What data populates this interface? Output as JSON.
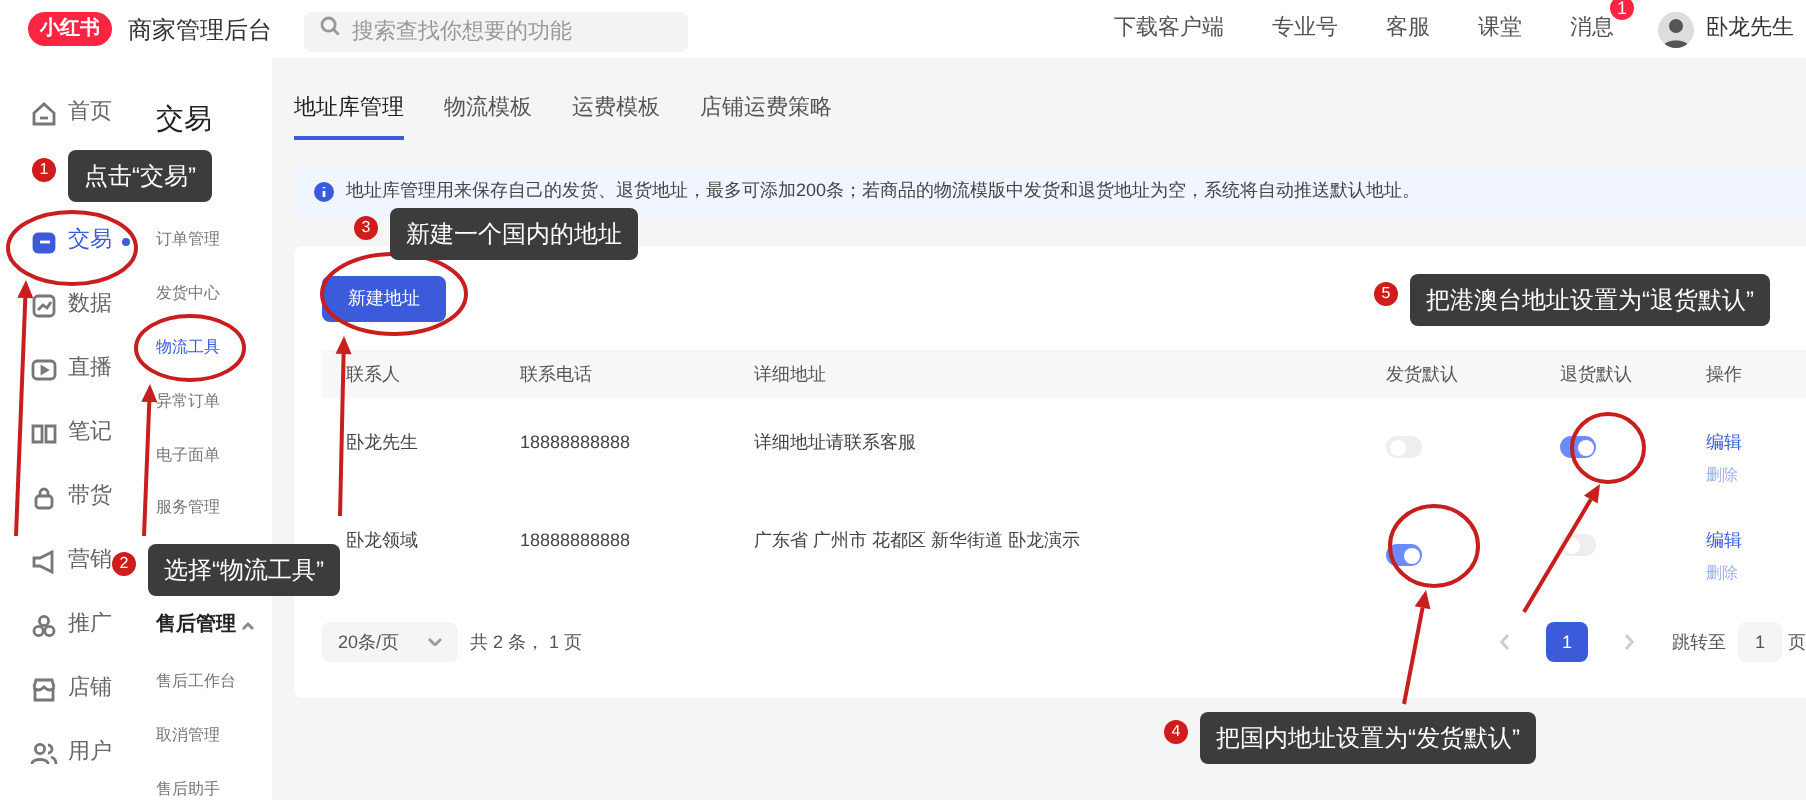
{
  "app": {
    "logo": "小红书",
    "title": "商家管理后台"
  },
  "search": {
    "placeholder": "搜索查找你想要的功能"
  },
  "top_links": [
    {
      "label": "下载客户端"
    },
    {
      "label": "专业号"
    },
    {
      "label": "客服"
    },
    {
      "label": "课堂"
    },
    {
      "label": "消息",
      "badge": "1"
    }
  ],
  "user": {
    "name": "卧龙先生"
  },
  "nav": [
    {
      "label": "首页",
      "selected": false
    },
    {
      "label": "交易",
      "selected": true
    },
    {
      "label": "数据",
      "selected": false
    },
    {
      "label": "直播",
      "selected": false
    },
    {
      "label": "笔记",
      "selected": false
    },
    {
      "label": "带货",
      "selected": false
    },
    {
      "label": "营销",
      "selected": false
    },
    {
      "label": "推广",
      "selected": false
    },
    {
      "label": "店铺",
      "selected": false
    },
    {
      "label": "用户",
      "selected": false
    }
  ],
  "submenu": {
    "title": "交易",
    "groups": [
      {
        "items": [
          {
            "label": "订单管理",
            "selected": false
          },
          {
            "label": "发货中心",
            "selected": false
          },
          {
            "label": "物流工具",
            "selected": true
          },
          {
            "label": "异常订单",
            "selected": false
          },
          {
            "label": "电子面单",
            "selected": false
          },
          {
            "label": "服务管理",
            "selected": false
          }
        ]
      },
      {
        "title": "售后管理",
        "expanded": true,
        "items": [
          {
            "label": "售后工作台",
            "selected": false
          },
          {
            "label": "取消管理",
            "selected": false
          },
          {
            "label": "售后助手",
            "selected": false
          }
        ]
      }
    ]
  },
  "tabs": [
    {
      "label": "地址库管理",
      "selected": true
    },
    {
      "label": "物流模板",
      "selected": false
    },
    {
      "label": "运费模板",
      "selected": false
    },
    {
      "label": "店铺运费策略",
      "selected": false
    }
  ],
  "notice": "地址库管理用来保存自己的发货、退货地址，最多可添加200条；若商品的物流模版中发货和退货地址为空，系统将自动推送默认地址。",
  "new_button": "新建地址",
  "table": {
    "columns": [
      "联系人",
      "联系电话",
      "详细地址",
      "发货默认",
      "退货默认",
      "操作"
    ],
    "rows": [
      {
        "contact": "卧龙先生",
        "phone": "18888888888",
        "address": "详细地址请联系客服",
        "ship_default": false,
        "return_default": true,
        "actions": [
          "编辑",
          "删除"
        ]
      },
      {
        "contact": "卧龙领域",
        "phone": "18888888888",
        "address": "广东省 广州市 花都区 新华街道 卧龙演示",
        "ship_default": true,
        "return_default": false,
        "actions": [
          "编辑",
          "删除"
        ]
      }
    ]
  },
  "pagination": {
    "page_size": "20条/页",
    "summary": "共 2 条， 1 页",
    "pages": [
      {
        "label": "1",
        "selected": true
      }
    ],
    "jump_label": "跳转至",
    "jump_value": "1",
    "jump_suffix": "页"
  },
  "annotations": [
    {
      "number": "1",
      "text": "点击“交易”"
    },
    {
      "number": "2",
      "text": "选择“物流工具”"
    },
    {
      "number": "3",
      "text": "新建一个国内的地址"
    },
    {
      "number": "4",
      "text": "把国内地址设置为“发货默认”"
    },
    {
      "number": "5",
      "text": "把港澳台地址设置为“退货默认”"
    }
  ]
}
